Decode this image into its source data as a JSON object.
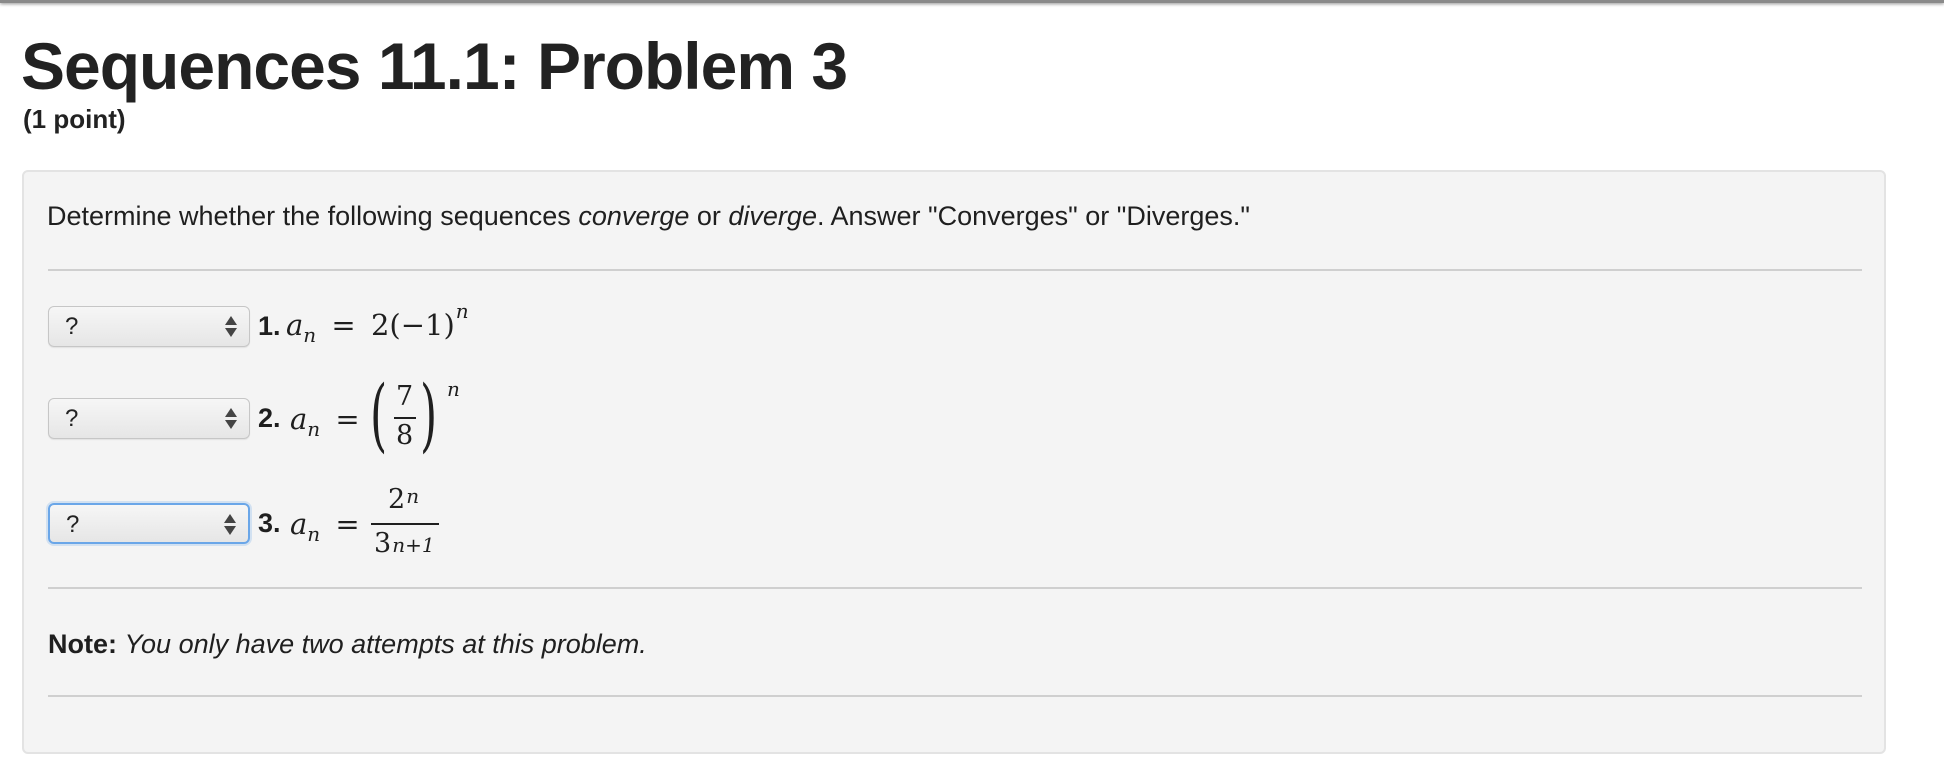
{
  "header": {
    "title": "Sequences 11.1: Problem 3",
    "points": "(1 point)"
  },
  "instructions": {
    "part1": "Determine whether the following sequences ",
    "converge": "converge",
    "part2": " or ",
    "diverge": "diverge",
    "part3": ". Answer \"Converges\" or \"Diverges.\""
  },
  "questions": [
    {
      "number": "1.",
      "select_value": "?",
      "a": "a",
      "sub": "n",
      "eq": "=",
      "expr": "2(−1)",
      "exp": "n"
    },
    {
      "number": "2.",
      "select_value": "?",
      "a": "a",
      "sub": "n",
      "eq": "=",
      "numerator": "7",
      "denominator": "8",
      "exp": "n"
    },
    {
      "number": "3.",
      "select_value": "?",
      "a": "a",
      "sub": "n",
      "eq": "=",
      "num_base": "2",
      "num_exp": "n",
      "den_base": "3",
      "den_exp": "n+1"
    }
  ],
  "note": {
    "label": "Note:",
    "text": "You only have two attempts at this problem."
  },
  "icons": {
    "select_arrows": "updown-arrows-icon"
  }
}
